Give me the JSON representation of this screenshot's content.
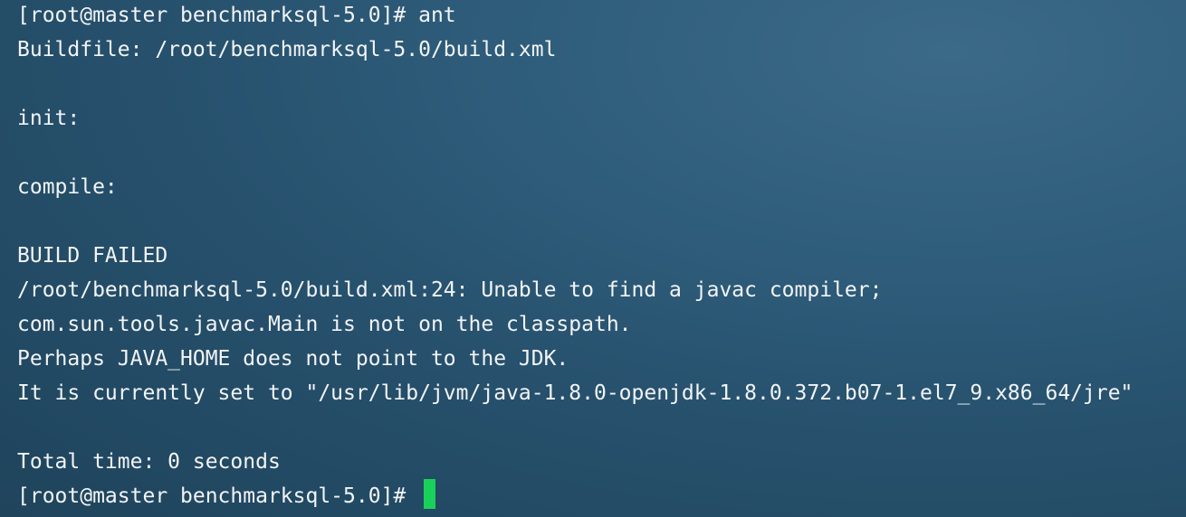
{
  "terminal": {
    "lines": [
      "[root@master benchmarksql-5.0]# ant",
      "Buildfile: /root/benchmarksql-5.0/build.xml",
      "",
      "init:",
      "",
      "compile:",
      "",
      "BUILD FAILED",
      "/root/benchmarksql-5.0/build.xml:24: Unable to find a javac compiler;",
      "com.sun.tools.javac.Main is not on the classpath.",
      "Perhaps JAVA_HOME does not point to the JDK.",
      "It is currently set to \"/usr/lib/jvm/java-1.8.0-openjdk-1.8.0.372.b07-1.el7_9.x86_64/jre\"",
      "",
      "Total time: 0 seconds"
    ],
    "prompt": "[root@master benchmarksql-5.0]# ",
    "cursor_color": "#19d15a",
    "text_color": "#f2f4f5",
    "background_color": "#2a5470"
  }
}
